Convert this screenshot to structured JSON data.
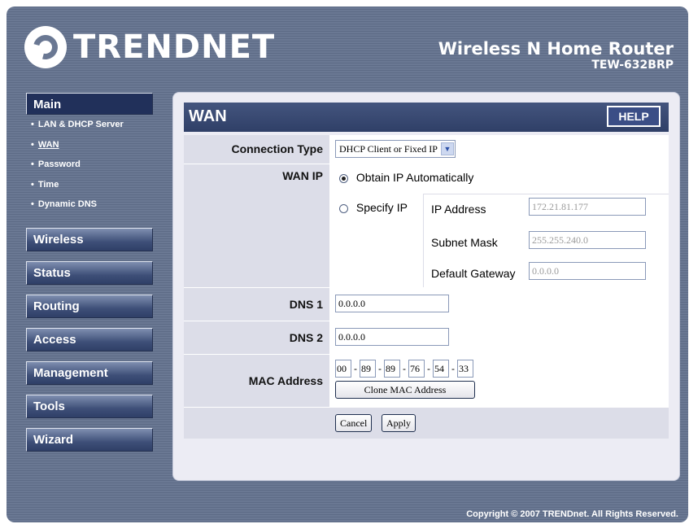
{
  "header": {
    "brand": "TRENDNET",
    "product_name": "Wireless N Home Router",
    "model": "TEW-632BRP"
  },
  "sidebar": {
    "main_label": "Main",
    "sub_items": [
      {
        "label": "LAN & DHCP Server",
        "active": false
      },
      {
        "label": "WAN",
        "active": true
      },
      {
        "label": "Password",
        "active": false
      },
      {
        "label": "Time",
        "active": false
      },
      {
        "label": "Dynamic DNS",
        "active": false
      }
    ],
    "menus": [
      "Wireless",
      "Status",
      "Routing",
      "Access",
      "Management",
      "Tools",
      "Wizard"
    ]
  },
  "page": {
    "title": "WAN",
    "help_label": "HELP"
  },
  "form": {
    "connection_type_label": "Connection Type",
    "connection_type_value": "DHCP Client or Fixed IP",
    "wan_ip_label": "WAN IP",
    "obtain_auto_label": "Obtain IP Automatically",
    "obtain_auto_selected": true,
    "specify_ip_label": "Specify IP",
    "ip_address_label": "IP Address",
    "ip_address_value": "172.21.81.177",
    "subnet_mask_label": "Subnet Mask",
    "subnet_mask_value": "255.255.240.0",
    "gateway_label": "Default Gateway",
    "gateway_value": "0.0.0.0",
    "dns1_label": "DNS 1",
    "dns1_value": "0.0.0.0",
    "dns2_label": "DNS 2",
    "dns2_value": "0.0.0.0",
    "mac_label": "MAC Address",
    "mac_octets": [
      "00",
      "89",
      "89",
      "76",
      "54",
      "33"
    ],
    "mac_separator": "-",
    "clone_mac_label": "Clone MAC Address",
    "cancel_label": "Cancel",
    "apply_label": "Apply"
  },
  "footer": {
    "copyright": "Copyright © 2007 TRENDnet. All Rights Reserved."
  },
  "colors": {
    "frame": "#6a7893",
    "title_bar": "#2f3f67",
    "label_cell": "#dcdde8"
  }
}
